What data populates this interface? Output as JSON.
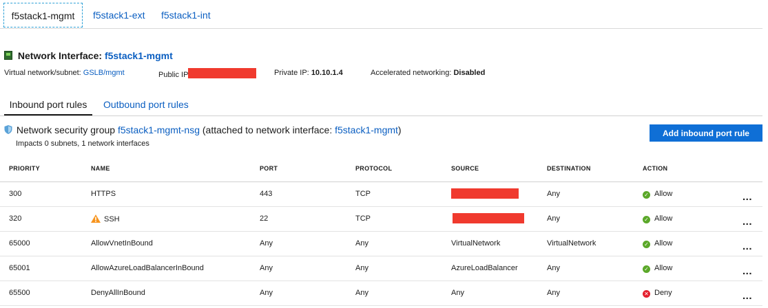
{
  "nic_tabs": [
    {
      "label": "f5stack1-mgmt",
      "active": true
    },
    {
      "label": "f5stack1-ext"
    },
    {
      "label": "f5stack1-int"
    }
  ],
  "nic": {
    "heading_prefix": "Network Interface:",
    "name": "f5stack1-mgmt",
    "vnet_label": "Virtual network/subnet:",
    "vnet_value": "GSLB/mgmt",
    "public_ip_label": "Public IP",
    "private_ip_label": "Private IP:",
    "private_ip_value": "10.10.1.4",
    "accel_label": "Accelerated networking:",
    "accel_value": "Disabled"
  },
  "rule_tabs": {
    "inbound": "Inbound port rules",
    "outbound": "Outbound port rules"
  },
  "nsg": {
    "prefix": "Network security group",
    "name": "f5stack1-mgmt-nsg",
    "attached_prefix": "(attached to network interface:",
    "attached_nic": "f5stack1-mgmt",
    "attached_suffix": ")",
    "impacts": "Impacts 0 subnets, 1 network interfaces"
  },
  "add_button": "Add inbound port rule",
  "table": {
    "headers": [
      "PRIORITY",
      "NAME",
      "PORT",
      "PROTOCOL",
      "SOURCE",
      "DESTINATION",
      "ACTION"
    ],
    "rows": [
      {
        "priority": "300",
        "name": "HTTPS",
        "port": "443",
        "protocol": "TCP",
        "source": "",
        "destination": "Any",
        "action": "Allow"
      },
      {
        "priority": "320",
        "name": "SSH",
        "port": "22",
        "protocol": "TCP",
        "source": "",
        "destination": "Any",
        "action": "Allow"
      },
      {
        "priority": "65000",
        "name": "AllowVnetInBound",
        "port": "Any",
        "protocol": "Any",
        "source": "VirtualNetwork",
        "destination": "VirtualNetwork",
        "action": "Allow"
      },
      {
        "priority": "65001",
        "name": "AllowAzureLoadBalancerInBound",
        "port": "Any",
        "protocol": "Any",
        "source": "AzureLoadBalancer",
        "destination": "Any",
        "action": "Allow"
      },
      {
        "priority": "65500",
        "name": "DenyAllInBound",
        "port": "Any",
        "protocol": "Any",
        "source": "Any",
        "destination": "Any",
        "action": "Deny"
      }
    ],
    "more": "..."
  },
  "icons": {
    "nic": "network-interface-icon",
    "nsg": "shield-icon",
    "warning": "warning-icon",
    "allow": "check-circle-icon",
    "deny": "x-circle-icon"
  },
  "colors": {
    "link": "#0a5ec1",
    "button": "#0f6fd6",
    "allow": "#5ba829",
    "deny": "#e4202e",
    "warning": "#f7941d",
    "redaction": "#f03a2e"
  }
}
